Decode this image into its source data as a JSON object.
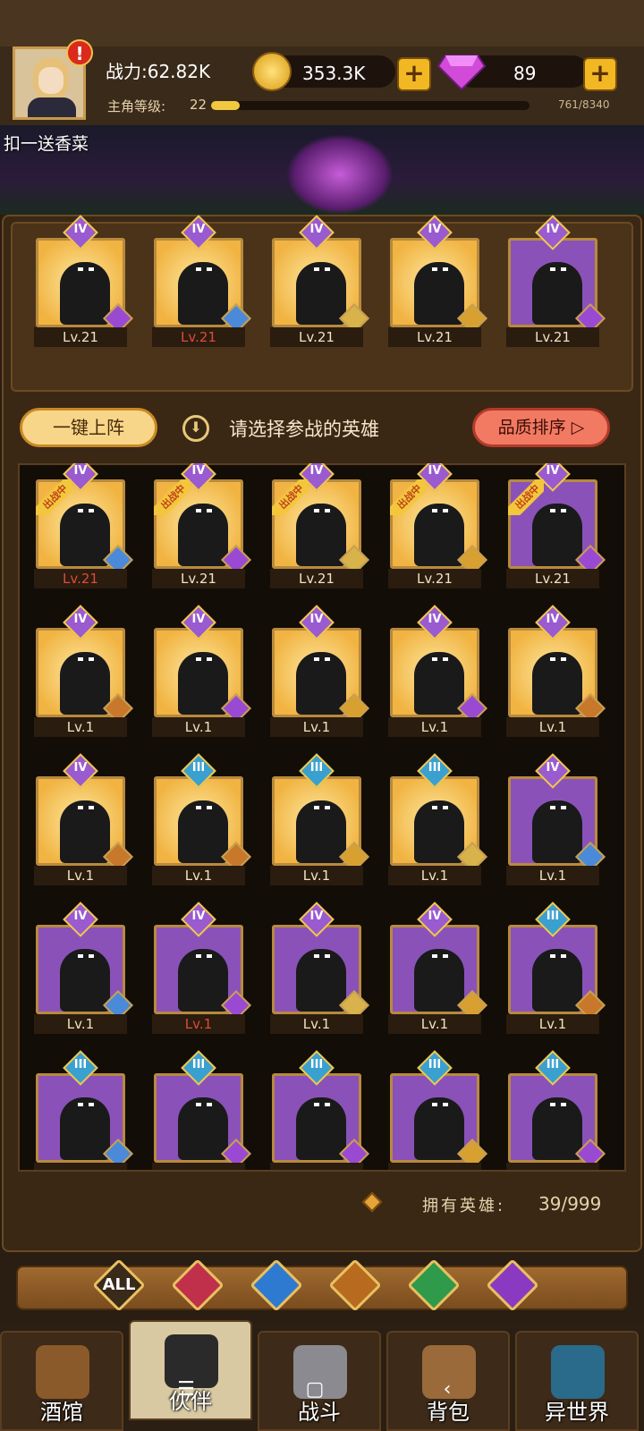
{
  "header": {
    "power_label": "战力:62.82K",
    "level_label": "主角等级:",
    "level_value": "22",
    "xp_text": "761/8340",
    "xp_progress": 0.09,
    "gold_value": "353.3K",
    "gem_value": "89",
    "plus_glyph": "+",
    "alert_glyph": "!"
  },
  "banner": {
    "text": "扣一送香菜"
  },
  "team": [
    {
      "rank": "IV",
      "level": "Lv.21",
      "level_red": false,
      "bg": "gold",
      "faction": "demon-icon",
      "faction_color": "#9a4ad2"
    },
    {
      "rank": "IV",
      "level": "Lv.21",
      "level_red": true,
      "bg": "gold",
      "faction": "naga-icon",
      "faction_color": "#4a8ad8"
    },
    {
      "rank": "IV",
      "level": "Lv.21",
      "level_red": false,
      "bg": "gold",
      "faction": "elf-icon",
      "faction_color": "#d8b24a"
    },
    {
      "rank": "IV",
      "level": "Lv.21",
      "level_red": false,
      "bg": "gold",
      "faction": "human-icon",
      "faction_color": "#d8a030"
    },
    {
      "rank": "IV",
      "level": "Lv.21",
      "level_red": false,
      "bg": "purple",
      "faction": "demon-icon",
      "faction_color": "#9a4ad2"
    }
  ],
  "actions": {
    "auto_deploy": "一键上阵",
    "select_hint": "请选择参战的英雄",
    "sort_label": "品质排序 ▷",
    "in_battle_tag": "出战中"
  },
  "roster": [
    {
      "rank": "IV",
      "level": "Lv.21",
      "level_red": true,
      "bg": "gold",
      "in_battle": true,
      "faction_color": "#4a8ad8"
    },
    {
      "rank": "IV",
      "level": "Lv.21",
      "level_red": false,
      "bg": "gold",
      "in_battle": true,
      "faction_color": "#9a4ad2"
    },
    {
      "rank": "IV",
      "level": "Lv.21",
      "level_red": false,
      "bg": "gold",
      "in_battle": true,
      "faction_color": "#d8b24a"
    },
    {
      "rank": "IV",
      "level": "Lv.21",
      "level_red": false,
      "bg": "gold",
      "in_battle": true,
      "faction_color": "#d8a030"
    },
    {
      "rank": "IV",
      "level": "Lv.21",
      "level_red": false,
      "bg": "purple",
      "in_battle": true,
      "faction_color": "#9a4ad2"
    },
    {
      "rank": "IV",
      "level": "Lv.1",
      "level_red": false,
      "bg": "gold",
      "in_battle": false,
      "faction_color": "#c8782a"
    },
    {
      "rank": "IV",
      "level": "Lv.1",
      "level_red": false,
      "bg": "gold",
      "in_battle": false,
      "faction_color": "#9a4ad2"
    },
    {
      "rank": "IV",
      "level": "Lv.1",
      "level_red": false,
      "bg": "gold",
      "in_battle": false,
      "faction_color": "#d8a030"
    },
    {
      "rank": "IV",
      "level": "Lv.1",
      "level_red": false,
      "bg": "gold",
      "in_battle": false,
      "faction_color": "#9a4ad2"
    },
    {
      "rank": "IV",
      "level": "Lv.1",
      "level_red": false,
      "bg": "gold",
      "in_battle": false,
      "faction_color": "#c8782a"
    },
    {
      "rank": "IV",
      "level": "Lv.1",
      "level_red": false,
      "bg": "gold",
      "in_battle": false,
      "faction_color": "#c8782a"
    },
    {
      "rank": "III",
      "level": "Lv.1",
      "level_red": false,
      "bg": "gold",
      "in_battle": false,
      "faction_color": "#c8782a"
    },
    {
      "rank": "III",
      "level": "Lv.1",
      "level_red": false,
      "bg": "gold",
      "in_battle": false,
      "faction_color": "#d8a030"
    },
    {
      "rank": "III",
      "level": "Lv.1",
      "level_red": false,
      "bg": "gold",
      "in_battle": false,
      "faction_color": "#d8b24a"
    },
    {
      "rank": "IV",
      "level": "Lv.1",
      "level_red": false,
      "bg": "purple",
      "in_battle": false,
      "faction_color": "#4a8ad8"
    },
    {
      "rank": "IV",
      "level": "Lv.1",
      "level_red": false,
      "bg": "purple",
      "in_battle": false,
      "faction_color": "#4a8ad8"
    },
    {
      "rank": "IV",
      "level": "Lv.1",
      "level_red": true,
      "bg": "purple",
      "in_battle": false,
      "faction_color": "#9a4ad2"
    },
    {
      "rank": "IV",
      "level": "Lv.1",
      "level_red": false,
      "bg": "purple",
      "in_battle": false,
      "faction_color": "#d8b24a"
    },
    {
      "rank": "IV",
      "level": "Lv.1",
      "level_red": false,
      "bg": "purple",
      "in_battle": false,
      "faction_color": "#d8a030"
    },
    {
      "rank": "III",
      "level": "Lv.1",
      "level_red": false,
      "bg": "purple",
      "in_battle": false,
      "faction_color": "#c8782a"
    },
    {
      "rank": "III",
      "level": "",
      "level_red": false,
      "bg": "purple",
      "in_battle": false,
      "faction_color": "#4a8ad8"
    },
    {
      "rank": "III",
      "level": "",
      "level_red": false,
      "bg": "purple",
      "in_battle": false,
      "faction_color": "#9a4ad2"
    },
    {
      "rank": "III",
      "level": "",
      "level_red": false,
      "bg": "purple",
      "in_battle": false,
      "faction_color": "#9a4ad2"
    },
    {
      "rank": "III",
      "level": "",
      "level_red": false,
      "bg": "purple",
      "in_battle": false,
      "faction_color": "#d8a030"
    },
    {
      "rank": "III",
      "level": "",
      "level_red": false,
      "bg": "purple",
      "in_battle": false,
      "faction_color": "#9a4ad2"
    }
  ],
  "owned": {
    "label": "拥有英雄:",
    "value": "39/999"
  },
  "filters": [
    {
      "name": "filter-all",
      "text": "ALL",
      "color": "#3a2a1a",
      "icon": "all-icon"
    },
    {
      "name": "filter-human",
      "text": "",
      "color": "#c0304a",
      "icon": "crown-icon"
    },
    {
      "name": "filter-naga",
      "text": "",
      "color": "#2e7ad0",
      "icon": "naga-icon"
    },
    {
      "name": "filter-beast",
      "text": "",
      "color": "#b86a1e",
      "icon": "lion-icon"
    },
    {
      "name": "filter-elf",
      "text": "",
      "color": "#2e9a4a",
      "icon": "elf-icon"
    },
    {
      "name": "filter-demon",
      "text": "",
      "color": "#8a3ac0",
      "icon": "demon-icon"
    }
  ],
  "nav": [
    {
      "label": "酒馆",
      "icon": "tavern-icon",
      "active": false
    },
    {
      "label": "伙伴",
      "icon": "partner-icon",
      "active": true
    },
    {
      "label": "战斗",
      "icon": "battle-icon",
      "active": false
    },
    {
      "label": "背包",
      "icon": "bag-icon",
      "active": false
    },
    {
      "label": "异世界",
      "icon": "portal-icon",
      "active": false
    }
  ],
  "system_nav": {
    "menu": "☰",
    "home": "▢",
    "back": "‹"
  }
}
